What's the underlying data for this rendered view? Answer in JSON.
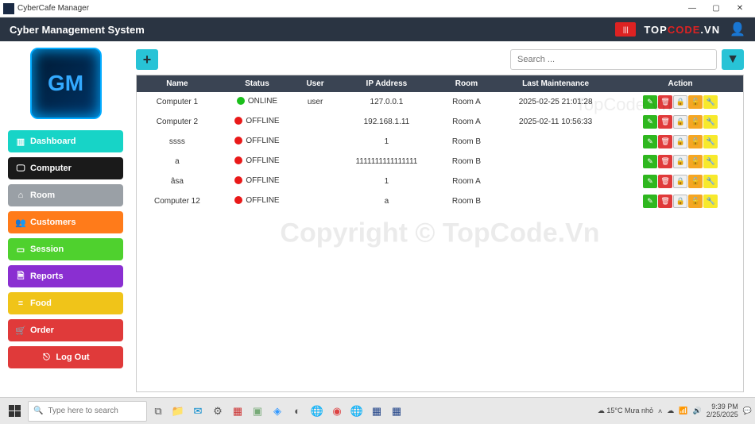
{
  "window": {
    "title": "CyberCafe Manager"
  },
  "header": {
    "title": "Cyber Management System",
    "brand": "TOPCODE.VN"
  },
  "sidebar": {
    "items": [
      {
        "label": "Dashboard",
        "cls": "dash",
        "icon": "▥"
      },
      {
        "label": "Computer",
        "cls": "comp",
        "icon": "🖵"
      },
      {
        "label": "Room",
        "cls": "room",
        "icon": "⌂"
      },
      {
        "label": "Customers",
        "cls": "cust",
        "icon": "👥"
      },
      {
        "label": "Session",
        "cls": "sess",
        "icon": "▭"
      },
      {
        "label": "Reports",
        "cls": "repo",
        "icon": "🗎"
      },
      {
        "label": "Food",
        "cls": "food",
        "icon": "≡"
      },
      {
        "label": "Order",
        "cls": "orde",
        "icon": "🛒"
      },
      {
        "label": "Log Out",
        "cls": "logo2",
        "icon": "⎋"
      }
    ]
  },
  "toolbar": {
    "search_placeholder": "Search ..."
  },
  "table": {
    "columns": [
      "Name",
      "Status",
      "User",
      "IP Address",
      "Room",
      "Last Maintenance",
      "Action"
    ],
    "rows": [
      {
        "name": "Computer 1",
        "status": "ONLINE",
        "user": "user",
        "ip": "127.0.0.1",
        "room": "Room A",
        "maint": "2025-02-25 21:01:28"
      },
      {
        "name": "Computer 2",
        "status": "OFFLINE",
        "user": "",
        "ip": "192.168.1.11",
        "room": "Room A",
        "maint": "2025-02-11 10:56:33"
      },
      {
        "name": "ssss",
        "status": "OFFLINE",
        "user": "",
        "ip": "1",
        "room": "Room B",
        "maint": ""
      },
      {
        "name": "a",
        "status": "OFFLINE",
        "user": "",
        "ip": "1111111111111111",
        "room": "Room B",
        "maint": ""
      },
      {
        "name": "âsa",
        "status": "OFFLINE",
        "user": "",
        "ip": "1",
        "room": "Room A",
        "maint": ""
      },
      {
        "name": "Computer 12",
        "status": "OFFLINE",
        "user": "",
        "ip": "a",
        "room": "Room B",
        "maint": ""
      }
    ]
  },
  "watermark": {
    "center": "Copyright © TopCode.Vn",
    "top": "TopCode.Vn"
  },
  "taskbar": {
    "search_placeholder": "Type here to search",
    "weather": "15°C  Mưa nhỏ",
    "time": "9:39 PM",
    "date": "2/25/2025"
  },
  "colors": {
    "header": "#2a3442",
    "accent": "#28c3d6",
    "online": "#1bbf1b",
    "offline": "#e91919"
  }
}
